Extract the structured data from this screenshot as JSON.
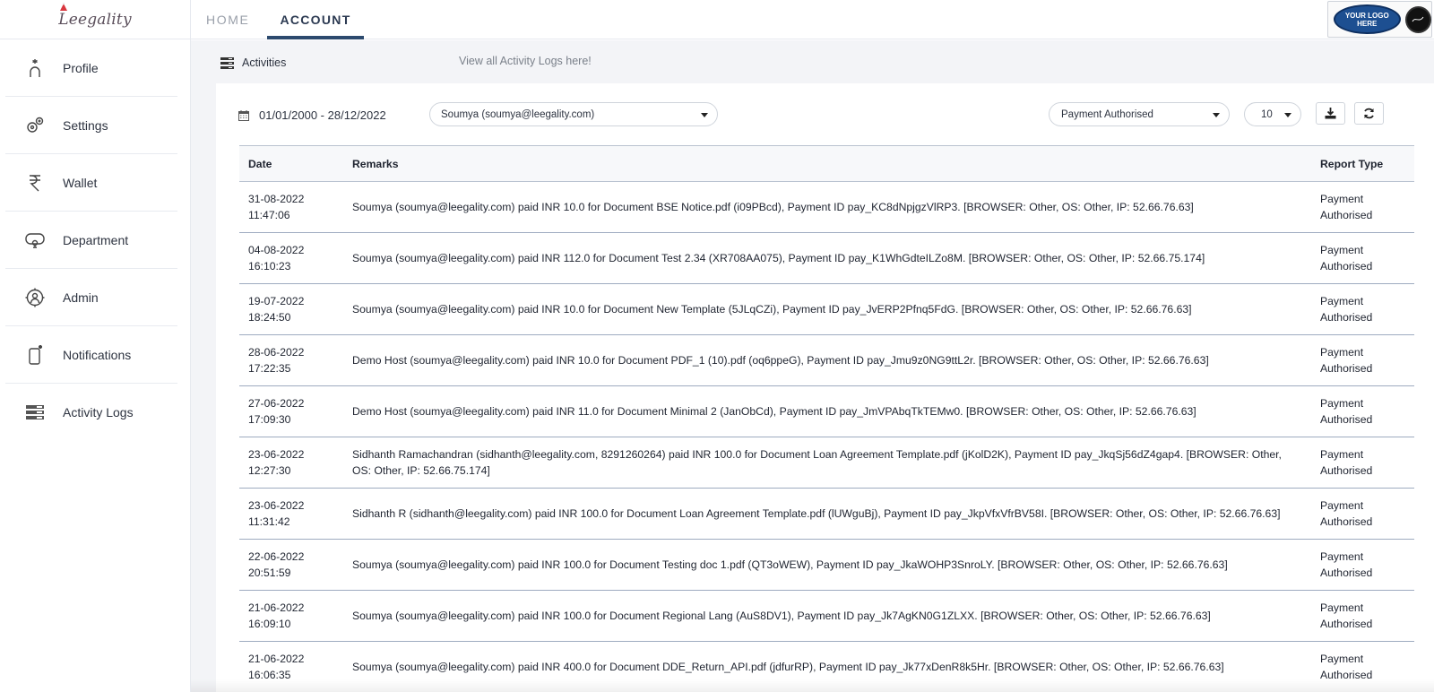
{
  "brand": {
    "logo_text": "Leegality"
  },
  "topbar": {
    "tabs": [
      {
        "label": "HOME"
      },
      {
        "label": "ACCOUNT"
      }
    ],
    "client_logo_text": "YOUR LOGO HERE"
  },
  "sidebar": {
    "items": [
      {
        "label": "Profile",
        "icon": "profile-icon"
      },
      {
        "label": "Settings",
        "icon": "settings-icon"
      },
      {
        "label": "Wallet",
        "icon": "wallet-icon"
      },
      {
        "label": "Department",
        "icon": "department-icon"
      },
      {
        "label": "Admin",
        "icon": "admin-icon"
      },
      {
        "label": "Notifications",
        "icon": "notifications-icon"
      },
      {
        "label": "Activity Logs",
        "icon": "activity-logs-icon"
      }
    ]
  },
  "main": {
    "section_title": "Activities",
    "view_all_text": "View all Activity Logs here!",
    "filters": {
      "date_range": "01/01/2000 - 28/12/2022",
      "user": "Soumya (soumya@leegality.com)",
      "report_type": "Payment Authorised",
      "page_size": "10"
    },
    "table": {
      "headers": {
        "date": "Date",
        "remarks": "Remarks",
        "report_type": "Report Type"
      },
      "rows": [
        {
          "date": "31-08-2022\n11:47:06",
          "remarks": "Soumya (soumya@leegality.com) paid INR 10.0 for Document BSE Notice.pdf (i09PBcd), Payment ID pay_KC8dNpjgzVlRP3. [BROWSER: Other, OS: Other, IP: 52.66.76.63]",
          "type": "Payment\nAuthorised"
        },
        {
          "date": "04-08-2022\n16:10:23",
          "remarks": "Soumya (soumya@leegality.com) paid INR 112.0 for Document Test 2.34 (XR708AA075), Payment ID pay_K1WhGdteILZo8M. [BROWSER: Other, OS: Other, IP: 52.66.75.174]",
          "type": "Payment\nAuthorised"
        },
        {
          "date": "19-07-2022\n18:24:50",
          "remarks": "Soumya (soumya@leegality.com) paid INR 10.0 for Document New Template (5JLqCZi), Payment ID pay_JvERP2Pfnq5FdG. [BROWSER: Other, OS: Other, IP: 52.66.76.63]",
          "type": "Payment\nAuthorised"
        },
        {
          "date": "28-06-2022\n17:22:35",
          "remarks": "Demo Host (soumya@leegality.com) paid INR 10.0 for Document PDF_1 (10).pdf (oq6ppeG), Payment ID pay_Jmu9z0NG9ttL2r. [BROWSER: Other, OS: Other, IP: 52.66.76.63]",
          "type": "Payment\nAuthorised"
        },
        {
          "date": "27-06-2022\n17:09:30",
          "remarks": "Demo Host (soumya@leegality.com) paid INR 11.0 for Document Minimal 2 (JanObCd), Payment ID pay_JmVPAbqTkTEMw0. [BROWSER: Other, OS: Other, IP: 52.66.76.63]",
          "type": "Payment\nAuthorised"
        },
        {
          "date": "23-06-2022\n12:27:30",
          "remarks": "Sidhanth Ramachandran (sidhanth@leegality.com, 8291260264) paid INR 100.0 for Document Loan Agreement Template.pdf (jKolD2K), Payment ID pay_JkqSj56dZ4gap4. [BROWSER: Other, OS: Other, IP: 52.66.75.174]",
          "type": "Payment\nAuthorised"
        },
        {
          "date": "23-06-2022\n11:31:42",
          "remarks": "Sidhanth R (sidhanth@leegality.com) paid INR 100.0 for Document Loan Agreement Template.pdf (lUWguBj), Payment ID pay_JkpVfxVfrBV58I. [BROWSER: Other, OS: Other, IP: 52.66.76.63]",
          "type": "Payment\nAuthorised"
        },
        {
          "date": "22-06-2022\n20:51:59",
          "remarks": "Soumya (soumya@leegality.com) paid INR 100.0 for Document Testing doc 1.pdf (QT3oWEW), Payment ID pay_JkaWOHP3SnroLY. [BROWSER: Other, OS: Other, IP: 52.66.76.63]",
          "type": "Payment\nAuthorised"
        },
        {
          "date": "21-06-2022\n16:09:10",
          "remarks": "Soumya (soumya@leegality.com) paid INR 100.0 for Document Regional Lang (AuS8DV1), Payment ID pay_Jk7AgKN0G1ZLXX. [BROWSER: Other, OS: Other, IP: 52.66.76.63]",
          "type": "Payment\nAuthorised"
        },
        {
          "date": "21-06-2022\n16:06:35",
          "remarks": "Soumya (soumya@leegality.com) paid INR 400.0 for Document DDE_Return_API.pdf (jdfurRP), Payment ID pay_Jk77xDenR8k5Hr. [BROWSER: Other, OS: Other, IP: 52.66.76.63]",
          "type": "Payment\nAuthorised"
        }
      ]
    }
  },
  "colors": {
    "accent": "#2c4a6e",
    "border": "#cfd4db",
    "background": "#f3f4f7"
  }
}
